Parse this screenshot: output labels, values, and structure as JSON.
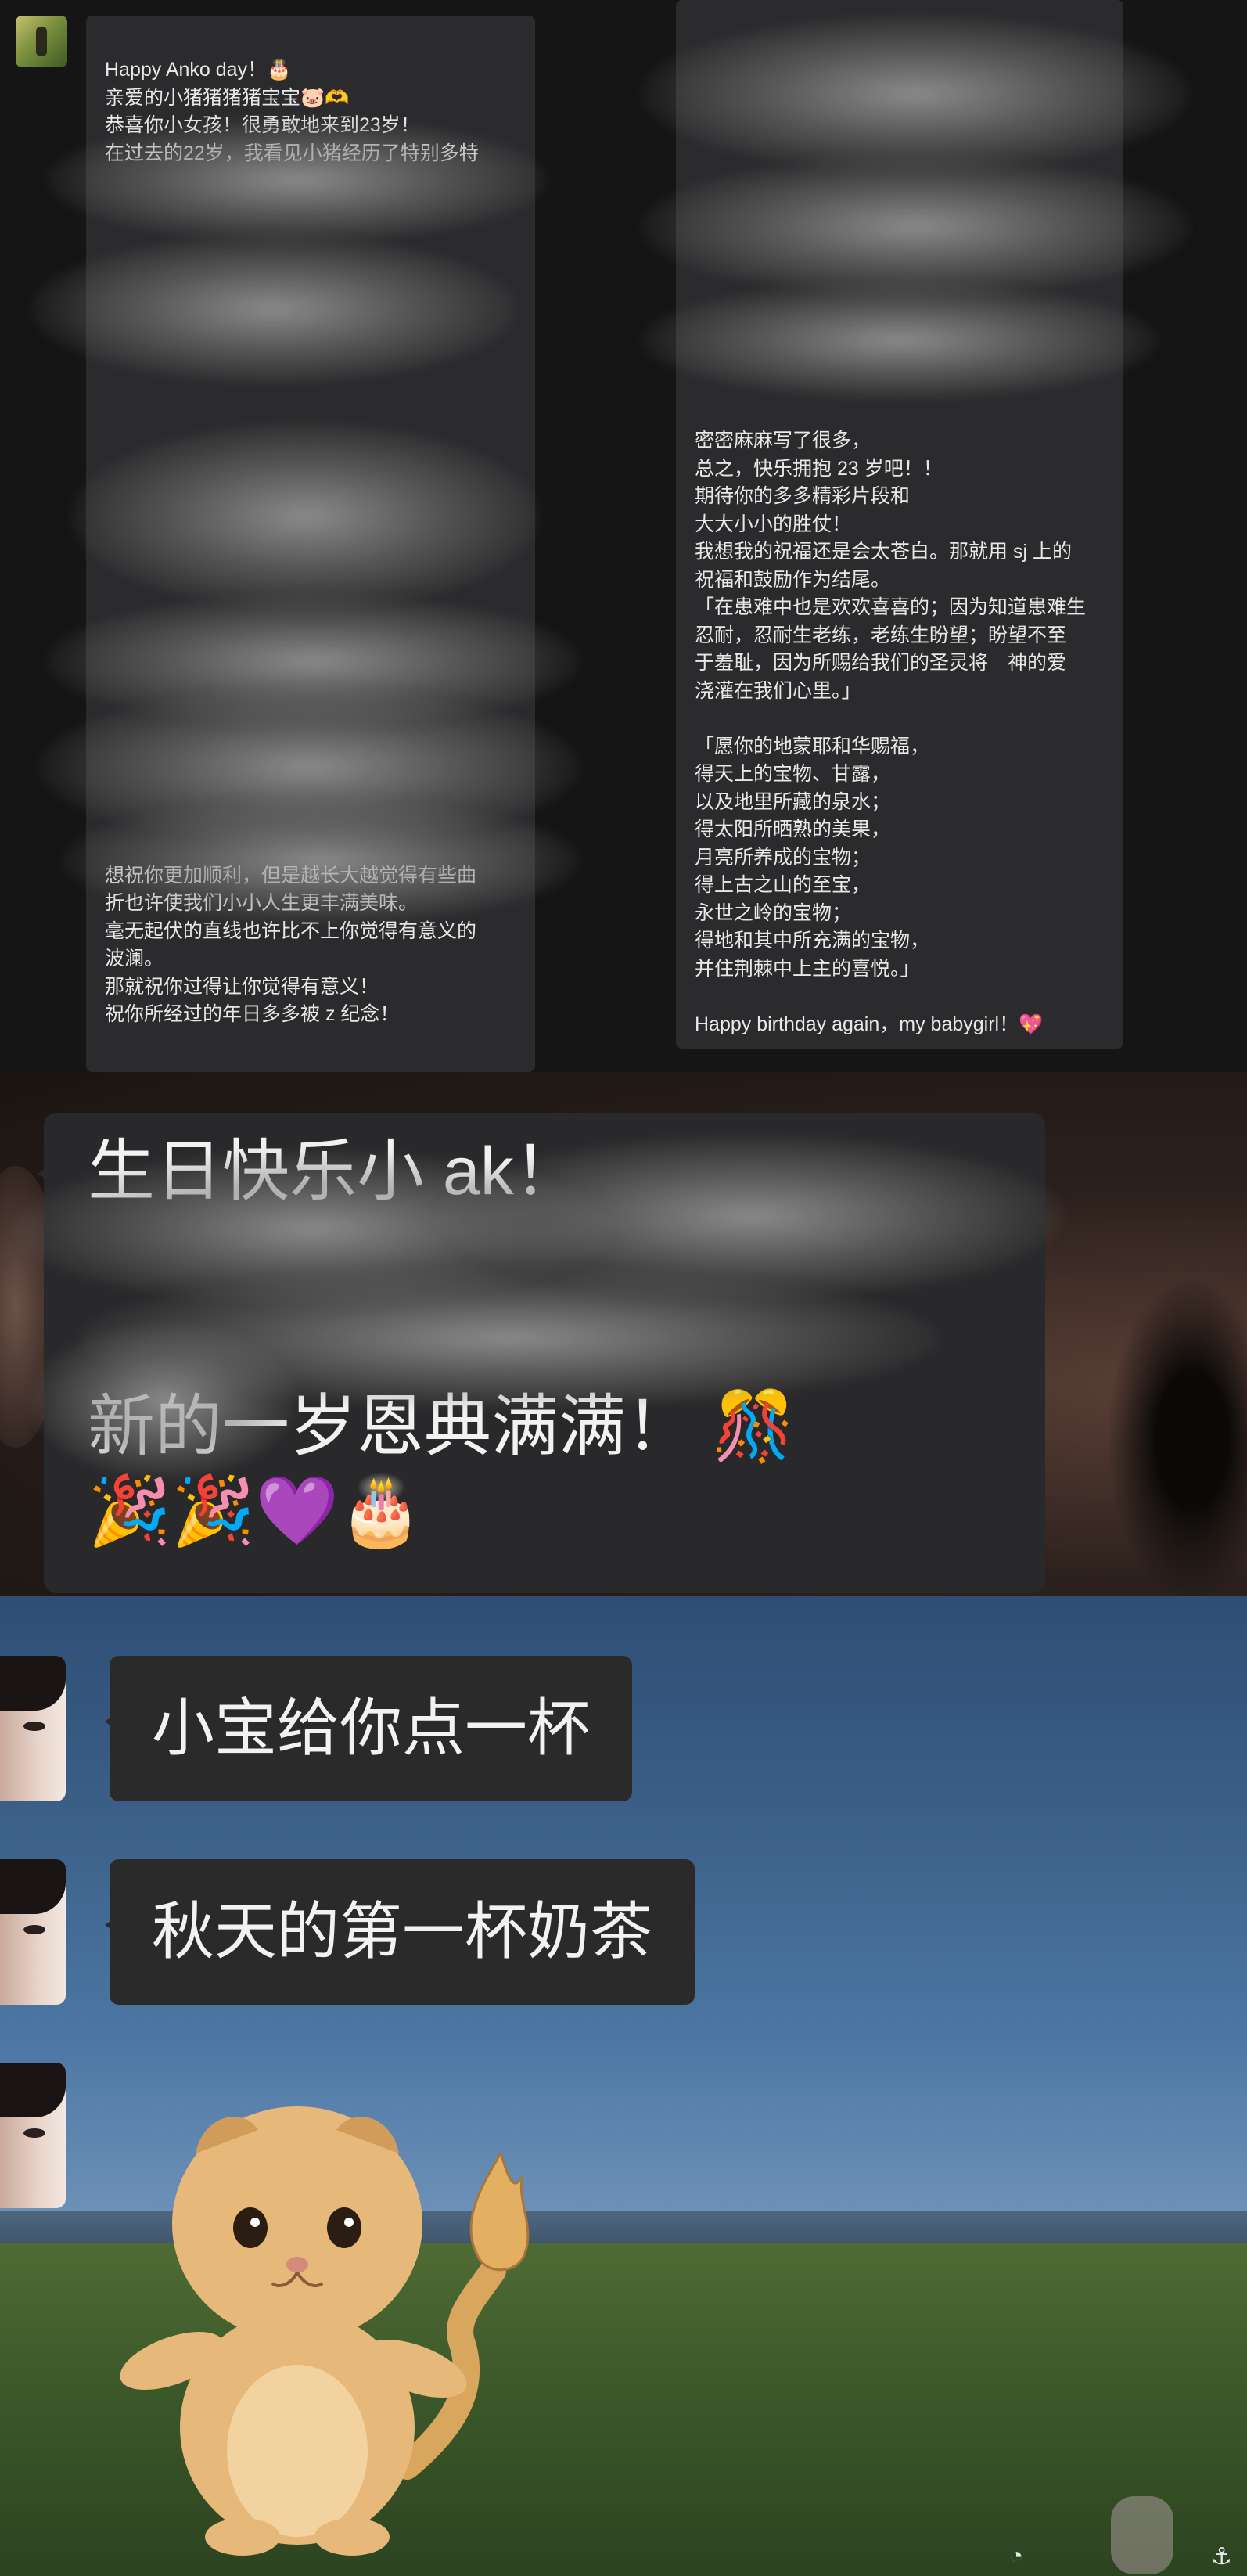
{
  "section1": {
    "left_message": {
      "lines": [
        "Happy Anko day！🎂",
        "亲爱的小猪猪猪猪宝宝🐷🫶",
        "恭喜你小女孩！很勇敢地来到23岁！",
        "在过去的22岁，我看见小猪经历了特别多特",
        "",
        "",
        "",
        "",
        "",
        "",
        "",
        "",
        "",
        "",
        "",
        "",
        "",
        "",
        "",
        "",
        "",
        "",
        "",
        "",
        "",
        "",
        "",
        "",
        "",
        "想祝你更加顺利，但是越长大越觉得有些曲",
        "折也许使我们小小人生更丰满美味。",
        "毫无起伏的直线也许比不上你觉得有意义的",
        "波澜。",
        "那就祝你过得让你觉得有意义！",
        "祝你所经过的年日多多被 z 纪念！"
      ]
    },
    "right_message": {
      "lines": [
        "密密麻麻写了很多，",
        "总之，快乐拥抱 23 岁吧！！",
        "期待你的多多精彩片段和",
        "大大小小的胜仗！",
        "我想我的祝福还是会太苍白。那就用 sj 上的",
        "祝福和鼓励作为结尾。",
        "「在患难中也是欢欢喜喜的；因为知道患难生",
        "忍耐，忍耐生老练，老练生盼望；盼望不至",
        "于羞耻，因为所赐给我们的圣灵将　神的爱",
        "浇灌在我们心里。」",
        "",
        "「愿你的地蒙耶和华赐福，",
        "得天上的宝物、甘露，",
        "以及地里所藏的泉水；",
        "得太阳所晒熟的美果，",
        "月亮所养成的宝物；",
        "得上古之山的至宝，",
        "永世之岭的宝物；",
        "得地和其中所充满的宝物，",
        "并住荆棘中上主的喜悦。」",
        "",
        "Happy birthday again，my babygirl！💖"
      ]
    }
  },
  "section2": {
    "line1": "生日快乐小 ak！",
    "line2": "新的一岁恩典满满！ 🎊",
    "line3": "🎉🎉💜🎂"
  },
  "section3": {
    "messages": [
      "小宝给你点一杯",
      "秋天的第一杯奶茶"
    ]
  },
  "colors": {
    "panel_bg": "#2b2b2d",
    "bubble_bg": "#2a2a2b",
    "text": "#f2f2f2"
  }
}
